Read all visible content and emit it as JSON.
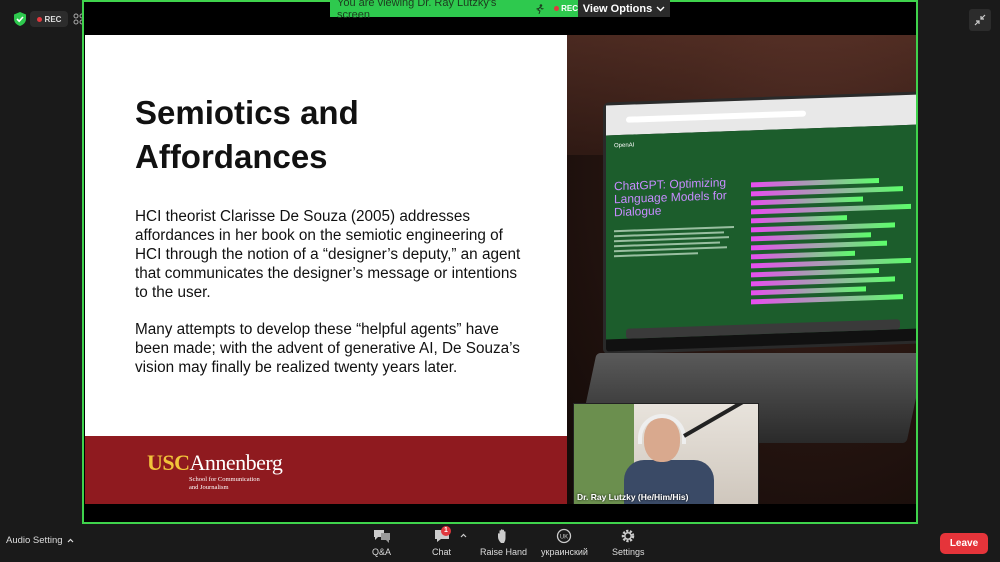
{
  "status": {
    "rec_label": "REC"
  },
  "banner": {
    "viewing_text": "You are viewing Dr. Ray Lutzky's screen",
    "rec_label": "REC",
    "view_options_label": "View Options"
  },
  "slide": {
    "title_line1": "Semiotics and",
    "title_line2": "Affordances",
    "paragraph1": "HCI theorist Clarisse De Souza (2005) addresses affordances in her book on the semiotic engineering of HCI through the notion of a “designer’s deputy,” an agent that communicates the designer’s message or intentions to the user.",
    "paragraph2": "Many attempts to develop these “helpful agents” have been made; with the advent of generative AI, De Souza’s vision may finally be realized twenty years later.",
    "logo_usc": "USC",
    "logo_annenberg": "Annenberg",
    "logo_sub_line1": "School for Communication",
    "logo_sub_line2": "and Journalism"
  },
  "photo": {
    "openai_label": "OpenAI",
    "chatgpt_title": "ChatGPT: Optimizing Language Models for Dialogue"
  },
  "video": {
    "participant_name": "Dr. Ray Lutzky (He/Him/His)"
  },
  "toolbar": {
    "audio_setting_label": "Audio Setting",
    "qa_label": "Q&A",
    "chat_label": "Chat",
    "chat_badge": "1",
    "raise_hand_label": "Raise Hand",
    "language_label": "украинский",
    "settings_label": "Settings",
    "leave_label": "Leave"
  },
  "colors": {
    "share_border": "#3fd34c",
    "banner_green": "#2ec94e",
    "leave_red": "#e5343a",
    "usc_cardinal": "#8f1a1f",
    "usc_gold": "#f1c43a"
  },
  "icons": [
    "shield-check-icon",
    "grid-icon",
    "exit-fullscreen-icon",
    "qa-icon",
    "chat-icon",
    "raise-hand-icon",
    "language-icon",
    "settings-icon",
    "chevron-up-icon",
    "chevron-down-icon",
    "running-man-icon"
  ]
}
